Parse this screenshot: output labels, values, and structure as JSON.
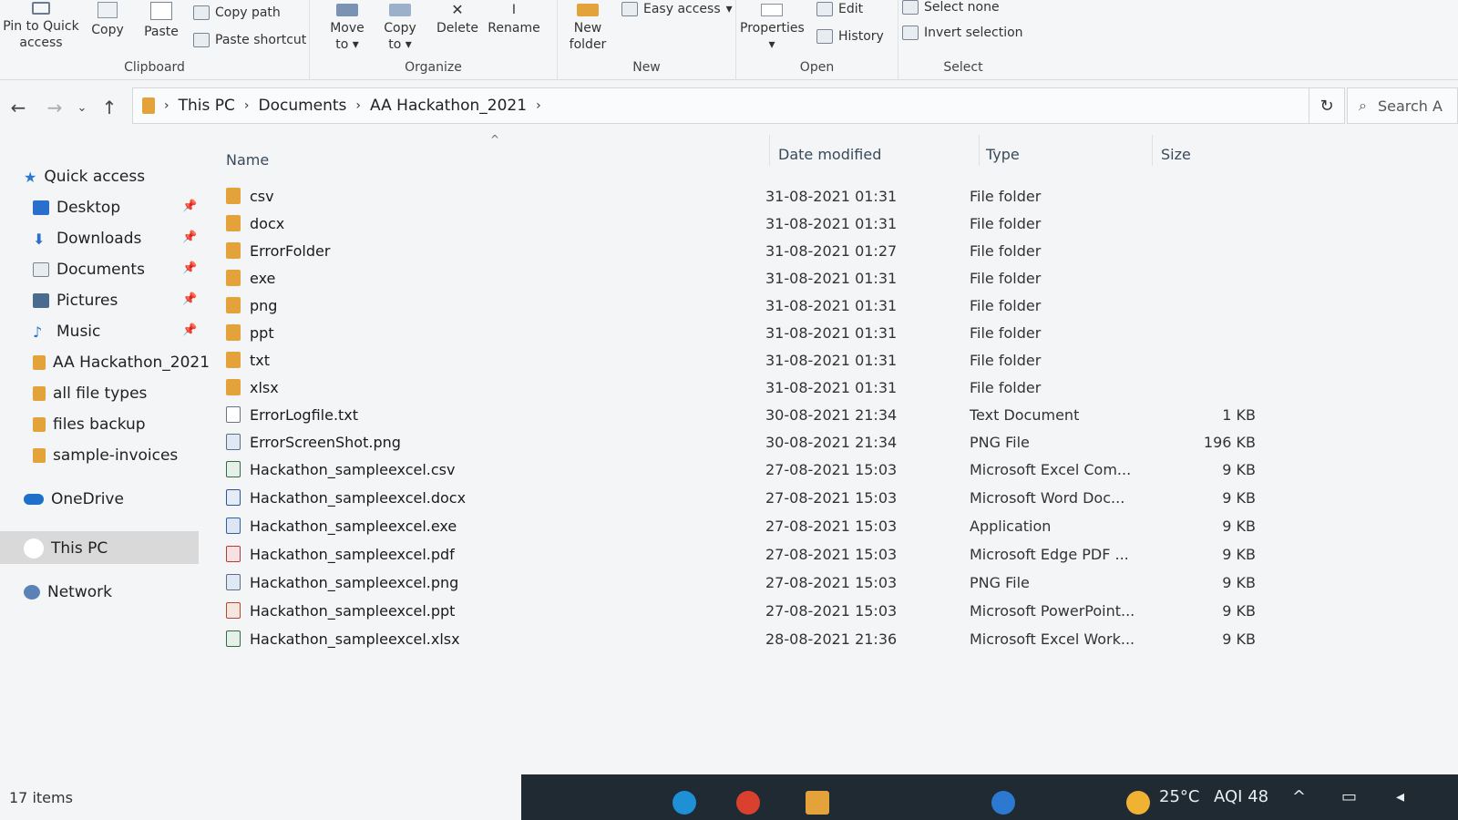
{
  "ribbon": {
    "clipboard": {
      "pin_label": "Pin to Quick access",
      "copy_label": "Copy",
      "paste_label": "Paste",
      "copy_path_label": "Copy path",
      "paste_shortcut_label": "Paste shortcut",
      "group_label": "Clipboard"
    },
    "organize": {
      "move_label": "Move to",
      "copy_to_label": "Copy to",
      "delete_label": "Delete",
      "rename_label": "Rename",
      "group_label": "Organize"
    },
    "new": {
      "new_folder_label": "New folder",
      "easy_access_label": "Easy access",
      "group_label": "New"
    },
    "open": {
      "properties_label": "Properties",
      "edit_label": "Edit",
      "history_label": "History",
      "group_label": "Open"
    },
    "select": {
      "select_none_label": "Select none",
      "invert_label": "Invert selection",
      "group_label": "Select"
    }
  },
  "address": {
    "crumbs": [
      "This PC",
      "Documents",
      "AA Hackathon_2021"
    ],
    "search_placeholder": "Search A"
  },
  "nav": {
    "quick_access": "Quick access",
    "pinned": [
      "Desktop",
      "Downloads",
      "Documents",
      "Pictures",
      "Music"
    ],
    "folders": [
      "AA Hackathon_2021",
      "all file types",
      "files backup",
      "sample-invoices"
    ],
    "onedrive": "OneDrive",
    "this_pc": "This PC",
    "network": "Network"
  },
  "columns": {
    "name": "Name",
    "date": "Date modified",
    "type": "Type",
    "size": "Size"
  },
  "files": [
    {
      "name": "csv",
      "date": "31-08-2021 01:31",
      "type": "File folder",
      "size": "",
      "icon": "folder"
    },
    {
      "name": "docx",
      "date": "31-08-2021 01:31",
      "type": "File folder",
      "size": "",
      "icon": "folder"
    },
    {
      "name": "ErrorFolder",
      "date": "31-08-2021 01:27",
      "type": "File folder",
      "size": "",
      "icon": "folder"
    },
    {
      "name": "exe",
      "date": "31-08-2021 01:31",
      "type": "File folder",
      "size": "",
      "icon": "folder"
    },
    {
      "name": "png",
      "date": "31-08-2021 01:31",
      "type": "File folder",
      "size": "",
      "icon": "folder"
    },
    {
      "name": "ppt",
      "date": "31-08-2021 01:31",
      "type": "File folder",
      "size": "",
      "icon": "folder"
    },
    {
      "name": "txt",
      "date": "31-08-2021 01:31",
      "type": "File folder",
      "size": "",
      "icon": "folder"
    },
    {
      "name": "xlsx",
      "date": "31-08-2021 01:31",
      "type": "File folder",
      "size": "",
      "icon": "folder"
    },
    {
      "name": "ErrorLogfile.txt",
      "date": "30-08-2021 21:34",
      "type": "Text Document",
      "size": "1 KB",
      "icon": "txt"
    },
    {
      "name": "ErrorScreenShot.png",
      "date": "30-08-2021 21:34",
      "type": "PNG File",
      "size": "196 KB",
      "icon": "img"
    },
    {
      "name": "Hackathon_sampleexcel.csv",
      "date": "27-08-2021 15:03",
      "type": "Microsoft Excel Com...",
      "size": "9 KB",
      "icon": "xls"
    },
    {
      "name": "Hackathon_sampleexcel.docx",
      "date": "27-08-2021 15:03",
      "type": "Microsoft Word Doc...",
      "size": "9 KB",
      "icon": "doc"
    },
    {
      "name": "Hackathon_sampleexcel.exe",
      "date": "27-08-2021 15:03",
      "type": "Application",
      "size": "9 KB",
      "icon": "exe"
    },
    {
      "name": "Hackathon_sampleexcel.pdf",
      "date": "27-08-2021 15:03",
      "type": "Microsoft Edge PDF ...",
      "size": "9 KB",
      "icon": "pdf"
    },
    {
      "name": "Hackathon_sampleexcel.png",
      "date": "27-08-2021 15:03",
      "type": "PNG File",
      "size": "9 KB",
      "icon": "img"
    },
    {
      "name": "Hackathon_sampleexcel.ppt",
      "date": "27-08-2021 15:03",
      "type": "Microsoft PowerPoint...",
      "size": "9 KB",
      "icon": "ppt"
    },
    {
      "name": "Hackathon_sampleexcel.xlsx",
      "date": "28-08-2021 21:36",
      "type": "Microsoft Excel Work...",
      "size": "9 KB",
      "icon": "xls"
    }
  ],
  "status": {
    "items": "17 items"
  },
  "taskbar": {
    "weather": "25°C",
    "aqi": "AQI 48"
  },
  "colors": {
    "folder": "#e3a33a",
    "selection": "#d9d9da",
    "taskbar": "#1f2a33"
  }
}
